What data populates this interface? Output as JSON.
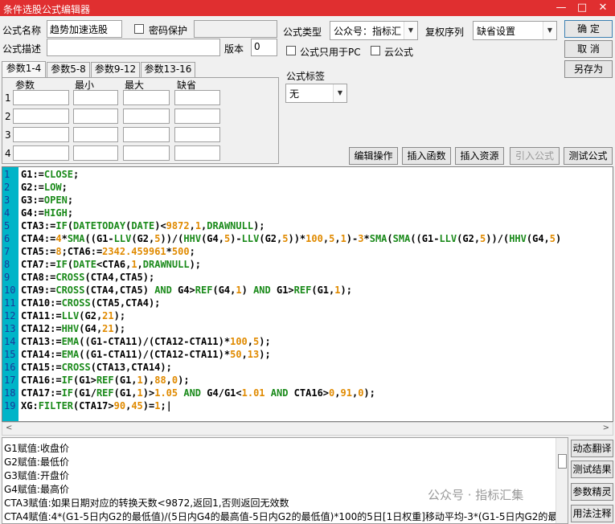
{
  "window": {
    "title": "条件选股公式编辑器",
    "minimize": "—",
    "maximize": "□",
    "close": "✕",
    "accent": "#e02f30"
  },
  "form": {
    "name_label": "公式名称",
    "name_value": "趋势加速选股",
    "password_label": "密码保护",
    "desc_label": "公式描述",
    "version_label": "版本",
    "version_value": "0",
    "type_label": "公式类型",
    "type_value": "公众号：指标汇",
    "rights_label": "复权序列",
    "rights_value": "缺省设置",
    "pc_only_label": "公式只用于PC",
    "cloud_label": "云公式",
    "tag_label": "公式标签",
    "tag_value": "无"
  },
  "buttons": {
    "ok": "确  定",
    "cancel": "取  消",
    "save_as": "另存为",
    "edit_op": "编辑操作",
    "insert_func": "插入函数",
    "insert_res": "插入资源",
    "import_formula": "引入公式",
    "test_formula": "测试公式",
    "dyn_translate": "动态翻译",
    "test_result": "测试结果",
    "param_tune": "参数精灵",
    "usage_note": "用法注释"
  },
  "tabs": [
    "参数1-4",
    "参数5-8",
    "参数9-12",
    "参数13-16"
  ],
  "params": {
    "headers": [
      "参数",
      "最小",
      "最大",
      "缺省"
    ],
    "rows": [
      "1",
      "2",
      "3",
      "4"
    ]
  },
  "code_lines": [
    "1",
    "2",
    "3",
    "4",
    "5",
    "6",
    "7",
    "8",
    "9",
    "10",
    "11",
    "12",
    "13",
    "14",
    "15",
    "16",
    "17",
    "18",
    "19"
  ],
  "description_lines": [
    "G1赋值:收盘价",
    "G2赋值:最低价",
    "G3赋值:开盘价",
    "G4赋值:最高价",
    "CTA3赋值:如果日期对应的转换天数<9872,返回1,否则返回无效数",
    "CTA4赋值:4*(G1-5日内G2的最低值)/(5日内G4的最高值-5日内G2的最低值)*100的5日[1日权重]移动平均-3*(G1-5日内G2的最"
  ],
  "watermark": "公众号 · 指标汇集"
}
